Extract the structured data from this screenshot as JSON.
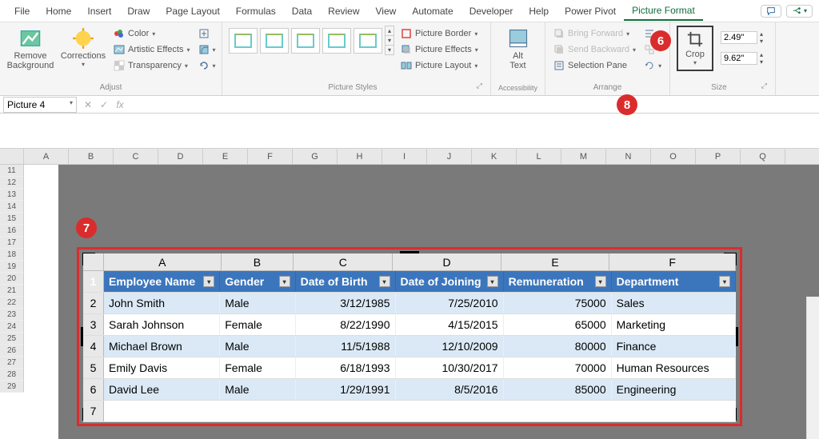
{
  "tabs": [
    "File",
    "Home",
    "Insert",
    "Draw",
    "Page Layout",
    "Formulas",
    "Data",
    "Review",
    "View",
    "Automate",
    "Developer",
    "Help",
    "Power Pivot",
    "Picture Format"
  ],
  "active_tab": "Picture Format",
  "ribbon": {
    "adjust": {
      "remove_bg": "Remove\nBackground",
      "corrections": "Corrections",
      "color": "Color",
      "artistic": "Artistic Effects",
      "transparency": "Transparency",
      "label": "Adjust"
    },
    "picture_styles": {
      "border": "Picture Border",
      "effects": "Picture Effects",
      "layout": "Picture Layout",
      "label": "Picture Styles"
    },
    "accessibility": {
      "alt_text": "Alt\nText",
      "label": "Accessibility"
    },
    "arrange": {
      "bring_forward": "Bring Forward",
      "send_backward": "Send Backward",
      "selection_pane": "Selection Pane",
      "label": "Arrange"
    },
    "crop": {
      "crop": "Crop"
    },
    "size": {
      "h": "2.49\"",
      "w": "9.62\"",
      "label": "Size"
    }
  },
  "name_box": "Picture 4",
  "outer_cols": [
    "A",
    "B",
    "C",
    "D",
    "E",
    "F",
    "G",
    "H",
    "I",
    "J",
    "K",
    "L",
    "M",
    "N",
    "O",
    "P",
    "Q"
  ],
  "outer_rows": [
    "11",
    "12",
    "13",
    "14",
    "15",
    "16",
    "17",
    "18",
    "19",
    "20",
    "21",
    "22",
    "23",
    "24",
    "25",
    "26",
    "27",
    "28",
    "29"
  ],
  "inner_cols": [
    "A",
    "B",
    "C",
    "D",
    "E",
    "F"
  ],
  "table": {
    "headers": [
      "Employee Name",
      "Gender",
      "Date of Birth",
      "Date of Joining",
      "Remuneration",
      "Department"
    ],
    "rows": [
      [
        "John Smith",
        "Male",
        "3/12/1985",
        "7/25/2010",
        "75000",
        "Sales"
      ],
      [
        "Sarah Johnson",
        "Female",
        "8/22/1990",
        "4/15/2015",
        "65000",
        "Marketing"
      ],
      [
        "Michael Brown",
        "Male",
        "11/5/1988",
        "12/10/2009",
        "80000",
        "Finance"
      ],
      [
        "Emily Davis",
        "Female",
        "6/18/1993",
        "10/30/2017",
        "70000",
        "Human Resources"
      ],
      [
        "David Lee",
        "Male",
        "1/29/1991",
        "8/5/2016",
        "85000",
        "Engineering"
      ]
    ]
  },
  "badges": {
    "b6": "6",
    "b7": "7",
    "b8": "8"
  },
  "chart_data": {
    "type": "table",
    "headers": [
      "Employee Name",
      "Gender",
      "Date of Birth",
      "Date of Joining",
      "Remuneration",
      "Department"
    ],
    "rows": [
      [
        "John Smith",
        "Male",
        "3/12/1985",
        "7/25/2010",
        75000,
        "Sales"
      ],
      [
        "Sarah Johnson",
        "Female",
        "8/22/1990",
        "4/15/2015",
        65000,
        "Marketing"
      ],
      [
        "Michael Brown",
        "Male",
        "11/5/1988",
        "12/10/2009",
        80000,
        "Finance"
      ],
      [
        "Emily Davis",
        "Female",
        "6/18/1993",
        "10/30/2017",
        70000,
        "Human Resources"
      ],
      [
        "David Lee",
        "Male",
        "1/29/1991",
        "8/5/2016",
        85000,
        "Engineering"
      ]
    ]
  }
}
